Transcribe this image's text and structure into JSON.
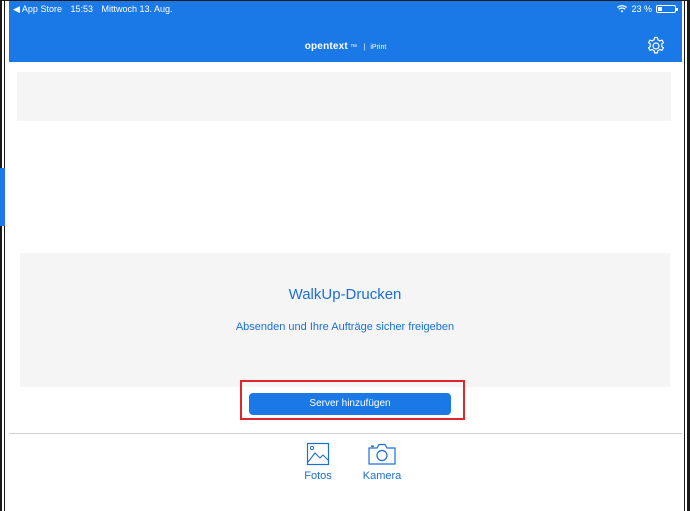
{
  "statusbar": {
    "back_app": "◀ App Store",
    "time": "15:53",
    "date": "Mittwoch 13. Aug.",
    "battery": "23 %",
    "battery_level": 0.23
  },
  "header": {
    "brand": "opentext",
    "brand_mark": "™",
    "separator": "|",
    "app_name": "iPrint"
  },
  "walkup": {
    "title": "WalkUp-Drucken",
    "subtitle": "Absenden und Ihre Aufträge sicher freigeben"
  },
  "actions": {
    "add_server": "Server hinzufügen"
  },
  "tabs": [
    {
      "label": "Fotos",
      "icon": "photo-icon"
    },
    {
      "label": "Kamera",
      "icon": "camera-icon"
    }
  ],
  "colors": {
    "accent": "#1a79e6",
    "highlight": "#e0262d",
    "panel": "#f5f5f5"
  }
}
